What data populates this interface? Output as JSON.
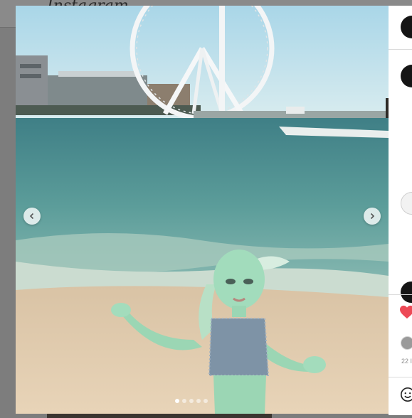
{
  "background": {
    "logo_text": "Instagram"
  },
  "media": {
    "prev_icon": "chevron-left-icon",
    "next_icon": "chevron-right-icon",
    "carousel_total": 5,
    "carousel_active": 0
  },
  "sidebar": {
    "like_icon": "heart-filled-icon",
    "like_color": "#ed4956",
    "date_label": "22 I",
    "emoji_icon": "emoji-icon"
  }
}
